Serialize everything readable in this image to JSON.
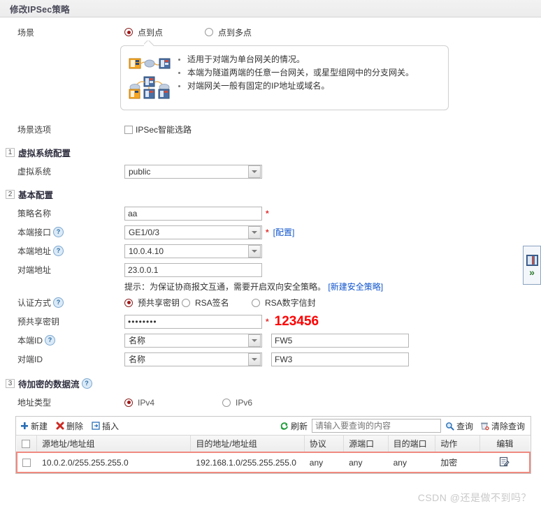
{
  "window": {
    "title": "修改IPSec策略"
  },
  "scene": {
    "label": "场景",
    "options": [
      {
        "label": "点到点",
        "selected": true
      },
      {
        "label": "点到多点",
        "selected": false
      }
    ],
    "callout": {
      "bullets": [
        "适用于对端为单台网关的情况。",
        "本端为隧道两端的任意一台网关，或星型组网中的分支网关。",
        "对端网关一般有固定的IP地址或域名。"
      ]
    },
    "option_row": {
      "label": "场景选项",
      "checkbox_label": "IPSec智能选路",
      "checked": false
    }
  },
  "section_vsys": {
    "number": "1",
    "title": "虚拟系统配置",
    "vsys": {
      "label": "虚拟系统",
      "value": "public"
    }
  },
  "section_basic": {
    "number": "2",
    "title": "基本配置",
    "policy_name": {
      "label": "策略名称",
      "value": "aa",
      "required": "*"
    },
    "local_if": {
      "label": "本端接口",
      "help": "?",
      "value": "GE1/0/3",
      "required": "*",
      "link": "[配置]"
    },
    "local_addr": {
      "label": "本端地址",
      "help": "?",
      "value": "10.0.4.10"
    },
    "peer_addr": {
      "label": "对端地址",
      "value": "23.0.0.1"
    },
    "hint": {
      "text": "提示：为保证协商报文互通，需要开启双向安全策略。",
      "link": "[新建安全策略]"
    },
    "auth": {
      "label": "认证方式",
      "help": "?",
      "options": [
        {
          "label": "预共享密钥",
          "selected": true
        },
        {
          "label": "RSA签名",
          "selected": false
        },
        {
          "label": "RSA数字信封",
          "selected": false
        }
      ]
    },
    "psk": {
      "label": "预共享密钥",
      "value": "••••••••",
      "required": "*",
      "annotation": "123456"
    },
    "local_id": {
      "label": "本端ID",
      "help": "?",
      "type": "名称",
      "value": "FW5"
    },
    "peer_id": {
      "label": "对端ID",
      "type": "名称",
      "value": "FW3"
    }
  },
  "section_flow": {
    "number": "3",
    "title": "待加密的数据流",
    "help": "?",
    "addr_type": {
      "label": "地址类型",
      "options": [
        {
          "label": "IPv4",
          "selected": true
        },
        {
          "label": "IPv6",
          "selected": false
        }
      ]
    },
    "toolbar": {
      "new": "新建",
      "delete": "删除",
      "insert": "插入",
      "refresh": "刷新",
      "search_placeholder": "请输入要查询的内容",
      "search_value": "",
      "query": "查询",
      "clear_query": "清除查询"
    },
    "table": {
      "columns": [
        "源地址/地址组",
        "目的地址/地址组",
        "协议",
        "源端口",
        "目的端口",
        "动作",
        "编辑"
      ],
      "rows": [
        {
          "checked": false,
          "src": "10.0.2.0/255.255.255.0",
          "dst": "192.168.1.0/255.255.255.0",
          "proto": "any",
          "sport": "any",
          "dport": "any",
          "action": "加密",
          "highlighted": true
        }
      ]
    }
  },
  "flyout": {
    "chevron": "»"
  },
  "watermark": {
    "text": "CSDN @还是做不到吗？"
  },
  "colors": {
    "accent_red": "#a01818",
    "annotation_red": "#ff0000",
    "link_blue": "#1155cc",
    "encrypt_green": "#49a832",
    "highlight_border": "#f08a80"
  }
}
